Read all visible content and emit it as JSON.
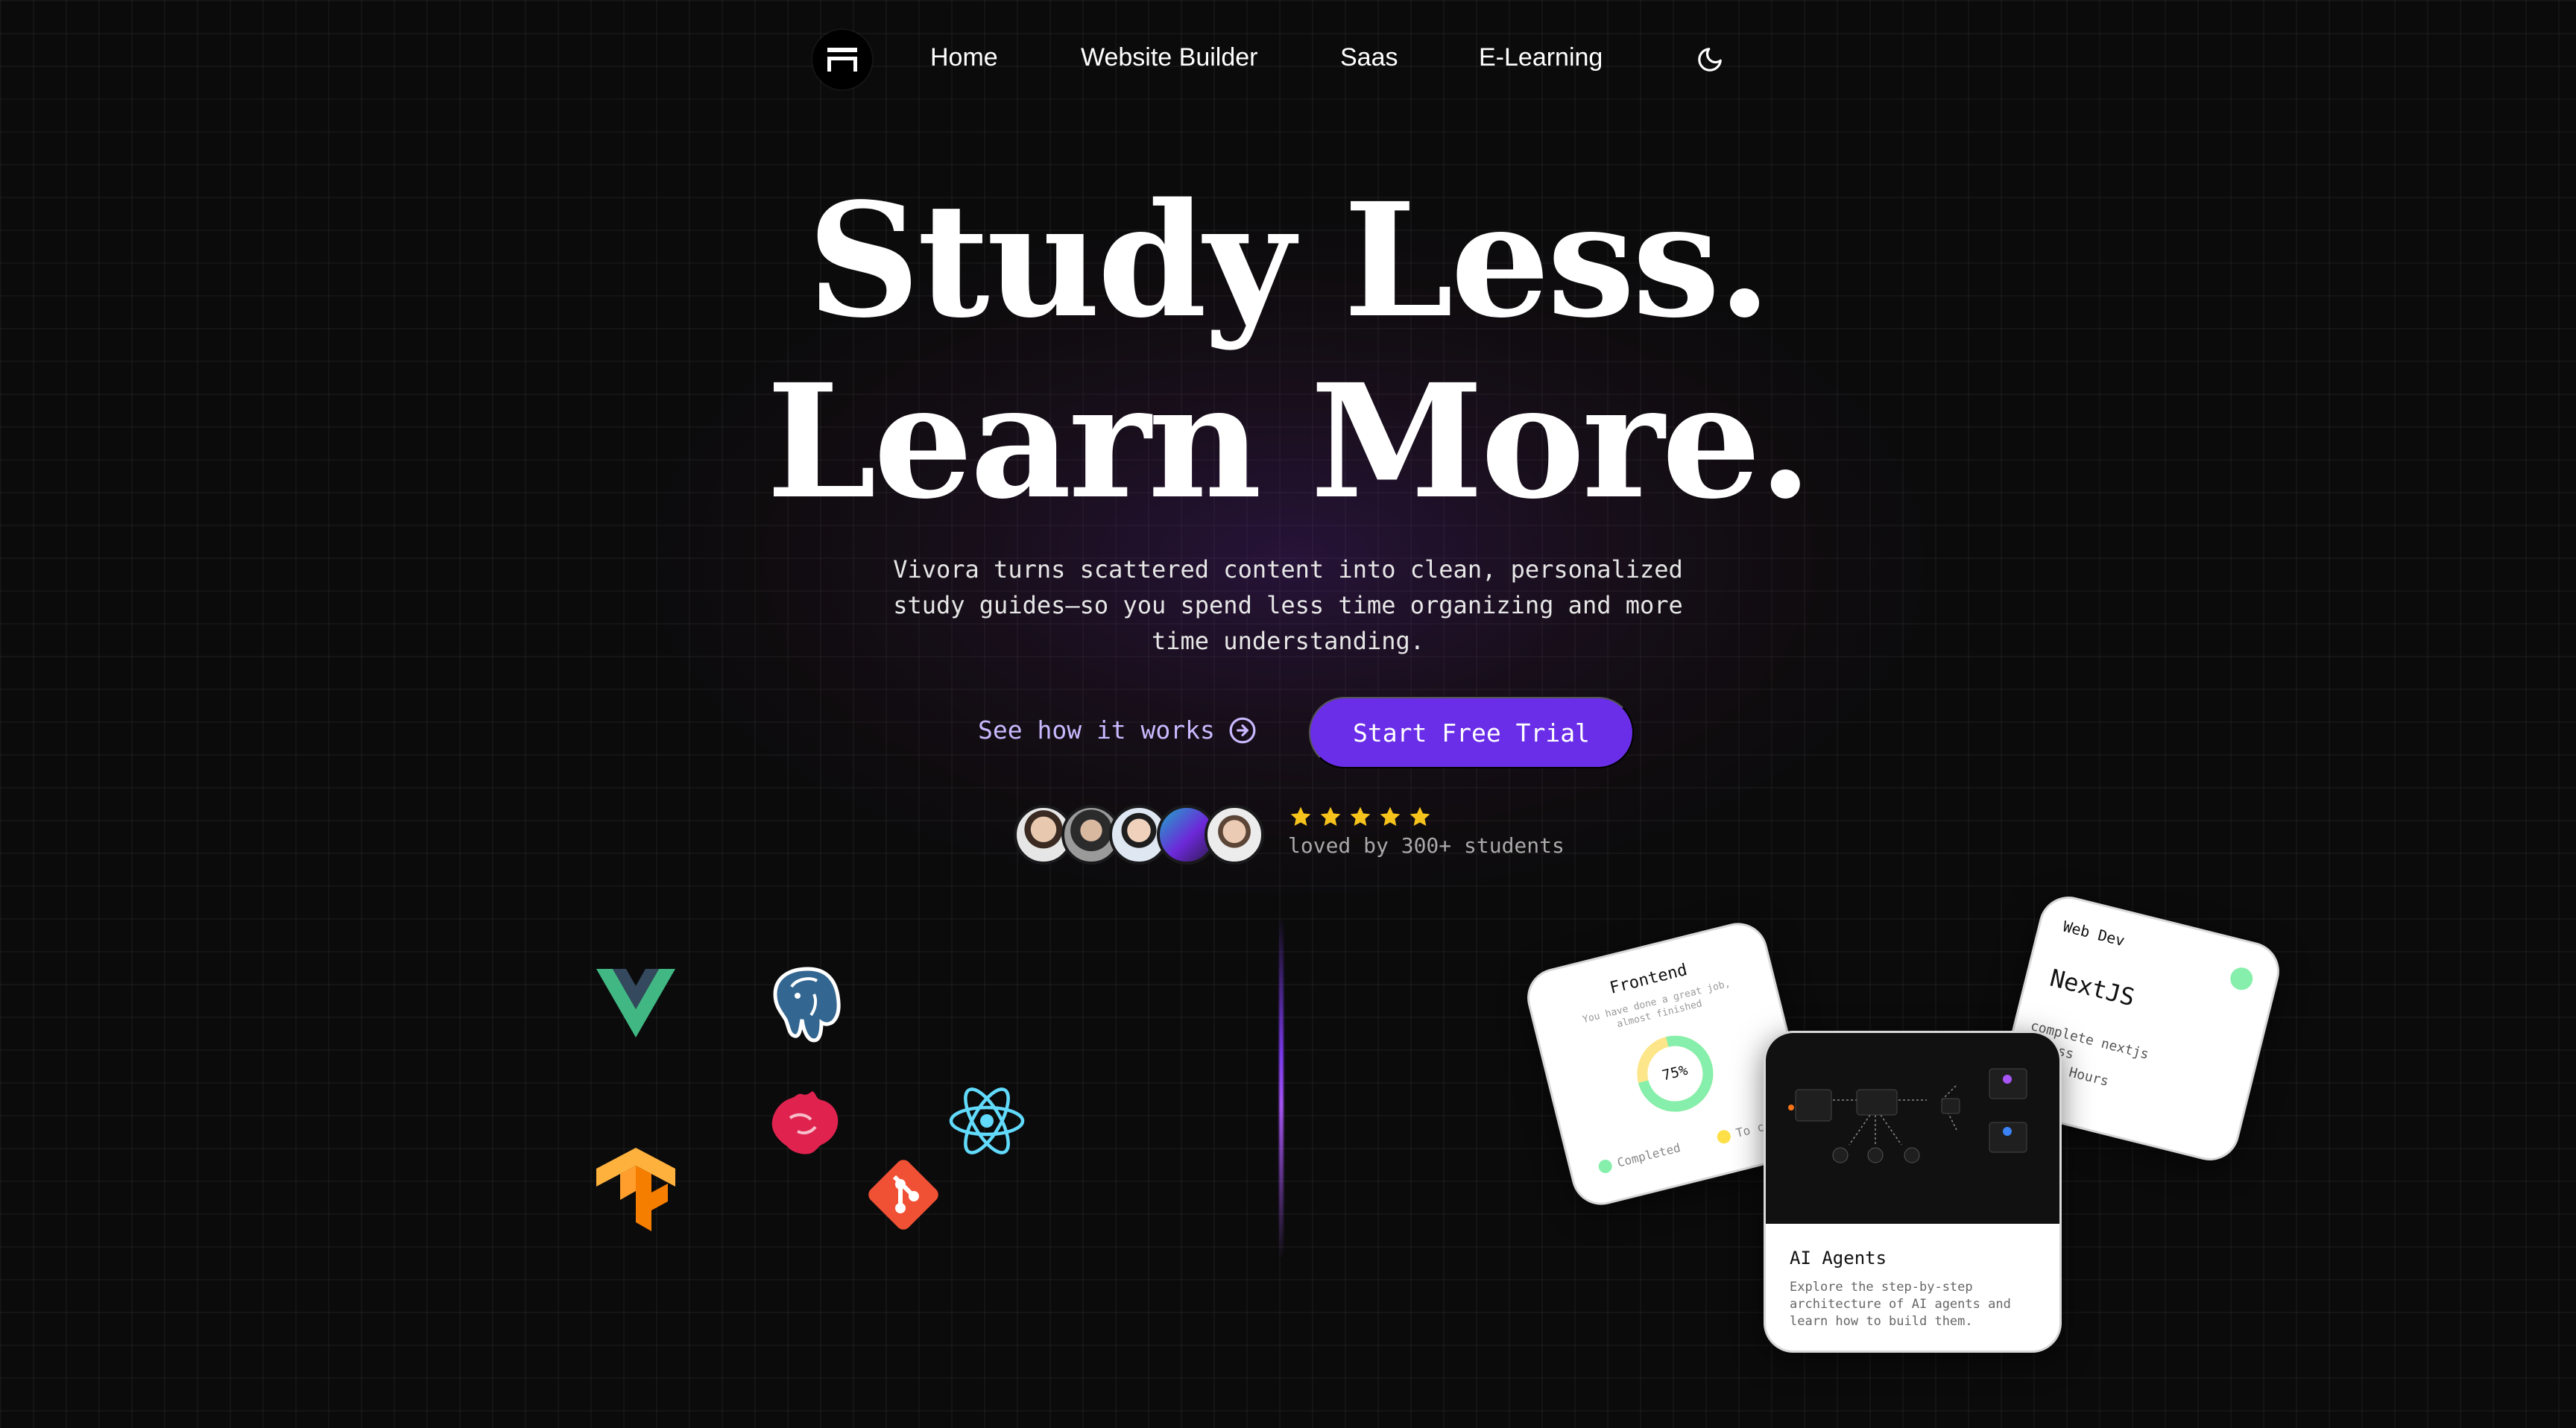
{
  "nav": {
    "links": [
      "Home",
      "Website Builder",
      "Saas",
      "E-Learning"
    ],
    "logo_icon": "logo-icon",
    "theme_icon": "moon-icon"
  },
  "hero": {
    "headline_line1": "Study Less.",
    "headline_line2": "Learn More.",
    "subtitle": "Vivora turns scattered content into clean, personalized study guides—so you spend less time organizing and more time understanding.",
    "secondary_cta": "See how it works",
    "primary_cta": "Start Free Trial",
    "rating": 5,
    "social_proof": "loved by 300+ students"
  },
  "tech_icons": [
    "vue-icon",
    "postgresql-icon",
    "nestjs-icon",
    "react-icon",
    "tensorflow-icon",
    "git-icon"
  ],
  "cards": {
    "frontend": {
      "title": "Frontend",
      "subtitle": "You have done a great job, almost finished",
      "progress_label": "75%",
      "progress": 0.75,
      "legend_completed": "Completed",
      "legend_todo": "To comp"
    },
    "webdev": {
      "tag": "Web Dev",
      "title": "NextJS",
      "line1": "complete nextjs",
      "line2": "rclass",
      "line3": "on: 3 Hours"
    },
    "ai": {
      "title": "AI Agents",
      "description": "Explore the step-by-step architecture of AI agents and learn how to build them."
    }
  },
  "colors": {
    "accent": "#6a2ee8",
    "accent_text": "#c9b9ff",
    "star": "#f6c21c",
    "progress_green": "#86efac",
    "progress_yellow": "#fde047"
  }
}
